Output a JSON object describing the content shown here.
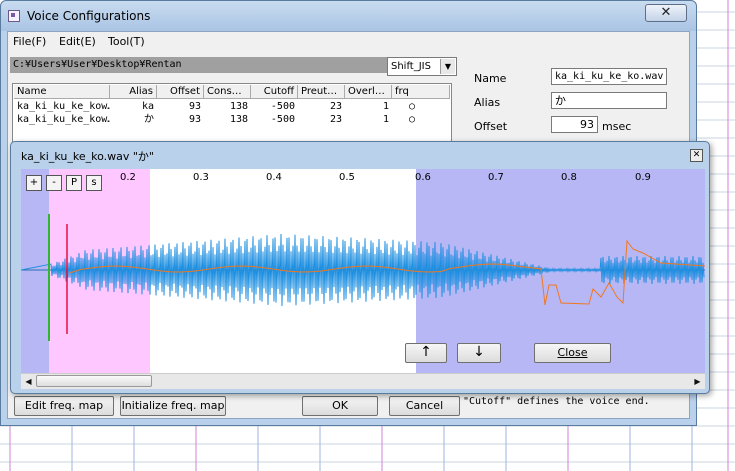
{
  "window": {
    "title": "Voice Configurations",
    "close_glyph": "✕"
  },
  "menu": [
    "File(F)",
    "Edit(E)",
    "Tool(T)"
  ],
  "path": "C:¥Users¥User¥Desktop¥Rentan",
  "encoding": {
    "selected": "Shift_JIS"
  },
  "table": {
    "headers": [
      "Name",
      "Alias",
      "Offset",
      "Cons…",
      "Cutoff",
      "Preut…",
      "Overl…",
      "frq"
    ],
    "rows": [
      [
        "ka_ki_ku_ke_kow…",
        "ka",
        "93",
        "138",
        "-500",
        "23",
        "1",
        "○"
      ],
      [
        "ka_ki_ku_ke_kow…",
        "か",
        "93",
        "138",
        "-500",
        "23",
        "1",
        "○"
      ]
    ]
  },
  "side": {
    "name_label": "Name",
    "name_value": "ka_ki_ku_ke_ko.wav",
    "alias_label": "Alias",
    "alias_value": "か",
    "offset_label": "Offset",
    "offset_value": "93",
    "offset_unit": "msec"
  },
  "wave_window": {
    "title": "ka_ki_ku_ke_ko.wav \"か\"",
    "close_glyph": "✕",
    "zoom_in": "+",
    "zoom_out": "-",
    "p_button": "P",
    "s_button": "s",
    "ticks": [
      "0.2",
      "0.3",
      "0.4",
      "0.5",
      "0.6",
      "0.7",
      "0.8",
      "0.9"
    ],
    "up_button": "↑",
    "down_button": "↓",
    "close_button": "Close",
    "scroll_left": "◀",
    "scroll_right": "▶",
    "colors": {
      "offset_region": "#b7b7f5",
      "consonant_region": "#ffc7ff",
      "cutoff_region": "#b7b7f5",
      "waveform": "#1e8fe0",
      "frequency": "#f07820"
    }
  },
  "buttons": {
    "edit_freq": "Edit freq. map",
    "init_freq": "Initialize freq. map",
    "ok": "OK",
    "cancel": "Cancel"
  },
  "status": "\"Cutoff\" defines the voice end."
}
